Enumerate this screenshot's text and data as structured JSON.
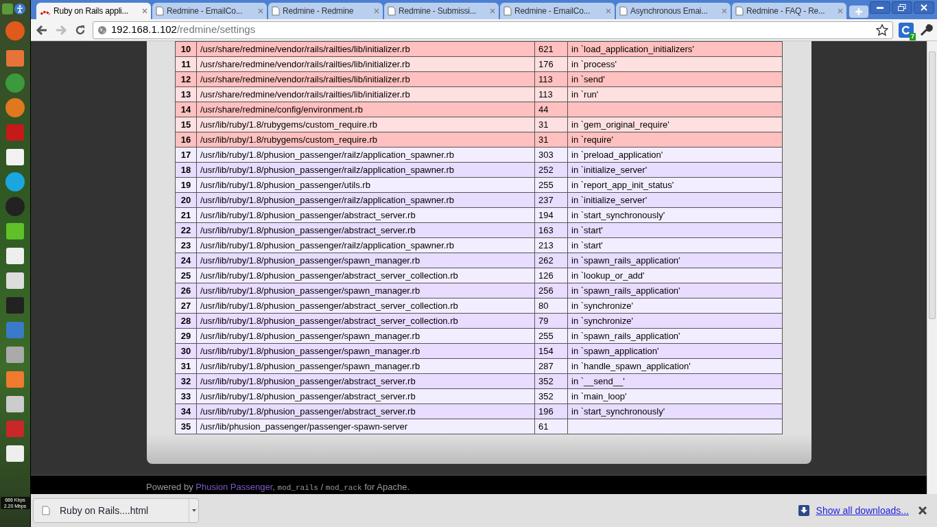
{
  "tabs": [
    {
      "label": "Ruby on Rails appli...",
      "selected": true,
      "kind": "rails"
    },
    {
      "label": "Redmine - EmailCo...",
      "selected": false,
      "kind": "page"
    },
    {
      "label": "Redmine - Redmine",
      "selected": false,
      "kind": "page"
    },
    {
      "label": "Redmine - Submissi...",
      "selected": false,
      "kind": "page"
    },
    {
      "label": "Redmine - EmailCo...",
      "selected": false,
      "kind": "page"
    },
    {
      "label": "Asynchronous Emai...",
      "selected": false,
      "kind": "page"
    },
    {
      "label": "Redmine - FAQ - Re...",
      "selected": false,
      "kind": "page"
    }
  ],
  "address": {
    "host": "192.168.1.102",
    "path": "/redmine/settings"
  },
  "extension_badge": "7",
  "launcher": {
    "net_up": "686 Kbps",
    "net_down": "2.20 Mbps"
  },
  "trace": [
    {
      "n": "10",
      "file": "/usr/share/redmine/vendor/rails/railties/lib/initializer.rb",
      "line": "621",
      "method": "in `load_application_initializers'",
      "kind": "app"
    },
    {
      "n": "11",
      "file": "/usr/share/redmine/vendor/rails/railties/lib/initializer.rb",
      "line": "176",
      "method": "in `process'",
      "kind": "app"
    },
    {
      "n": "12",
      "file": "/usr/share/redmine/vendor/rails/railties/lib/initializer.rb",
      "line": "113",
      "method": "in `send'",
      "kind": "app"
    },
    {
      "n": "13",
      "file": "/usr/share/redmine/vendor/rails/railties/lib/initializer.rb",
      "line": "113",
      "method": "in `run'",
      "kind": "app"
    },
    {
      "n": "14",
      "file": "/usr/share/redmine/config/environment.rb",
      "line": "44",
      "kind": "app"
    },
    {
      "n": "15",
      "file": "/usr/lib/ruby/1.8/rubygems/custom_require.rb",
      "line": "31",
      "method": "in `gem_original_require'",
      "kind": "app"
    },
    {
      "n": "16",
      "file": "/usr/lib/ruby/1.8/rubygems/custom_require.rb",
      "line": "31",
      "method": "in `require'",
      "kind": "app"
    },
    {
      "n": "17",
      "file": "/usr/lib/ruby/1.8/phusion_passenger/railz/application_spawner.rb",
      "line": "303",
      "method": "in `preload_application'",
      "kind": "framework"
    },
    {
      "n": "18",
      "file": "/usr/lib/ruby/1.8/phusion_passenger/railz/application_spawner.rb",
      "line": "252",
      "method": "in `initialize_server'",
      "kind": "framework"
    },
    {
      "n": "19",
      "file": "/usr/lib/ruby/1.8/phusion_passenger/utils.rb",
      "line": "255",
      "method": "in `report_app_init_status'",
      "kind": "framework"
    },
    {
      "n": "20",
      "file": "/usr/lib/ruby/1.8/phusion_passenger/railz/application_spawner.rb",
      "line": "237",
      "method": "in `initialize_server'",
      "kind": "framework"
    },
    {
      "n": "21",
      "file": "/usr/lib/ruby/1.8/phusion_passenger/abstract_server.rb",
      "line": "194",
      "method": "in `start_synchronously'",
      "kind": "framework"
    },
    {
      "n": "22",
      "file": "/usr/lib/ruby/1.8/phusion_passenger/abstract_server.rb",
      "line": "163",
      "method": "in `start'",
      "kind": "framework"
    },
    {
      "n": "23",
      "file": "/usr/lib/ruby/1.8/phusion_passenger/railz/application_spawner.rb",
      "line": "213",
      "method": "in `start'",
      "kind": "framework"
    },
    {
      "n": "24",
      "file": "/usr/lib/ruby/1.8/phusion_passenger/spawn_manager.rb",
      "line": "262",
      "method": "in `spawn_rails_application'",
      "kind": "framework"
    },
    {
      "n": "25",
      "file": "/usr/lib/ruby/1.8/phusion_passenger/abstract_server_collection.rb",
      "line": "126",
      "method": "in `lookup_or_add'",
      "kind": "framework"
    },
    {
      "n": "26",
      "file": "/usr/lib/ruby/1.8/phusion_passenger/spawn_manager.rb",
      "line": "256",
      "method": "in `spawn_rails_application'",
      "kind": "framework"
    },
    {
      "n": "27",
      "file": "/usr/lib/ruby/1.8/phusion_passenger/abstract_server_collection.rb",
      "line": "80",
      "method": "in `synchronize'",
      "kind": "framework"
    },
    {
      "n": "28",
      "file": "/usr/lib/ruby/1.8/phusion_passenger/abstract_server_collection.rb",
      "line": "79",
      "method": "in `synchronize'",
      "kind": "framework"
    },
    {
      "n": "29",
      "file": "/usr/lib/ruby/1.8/phusion_passenger/spawn_manager.rb",
      "line": "255",
      "method": "in `spawn_rails_application'",
      "kind": "framework"
    },
    {
      "n": "30",
      "file": "/usr/lib/ruby/1.8/phusion_passenger/spawn_manager.rb",
      "line": "154",
      "method": "in `spawn_application'",
      "kind": "framework"
    },
    {
      "n": "31",
      "file": "/usr/lib/ruby/1.8/phusion_passenger/spawn_manager.rb",
      "line": "287",
      "method": "in `handle_spawn_application'",
      "kind": "framework"
    },
    {
      "n": "32",
      "file": "/usr/lib/ruby/1.8/phusion_passenger/abstract_server.rb",
      "line": "352",
      "method": "in `__send__'",
      "kind": "framework"
    },
    {
      "n": "33",
      "file": "/usr/lib/ruby/1.8/phusion_passenger/abstract_server.rb",
      "line": "352",
      "method": "in `main_loop'",
      "kind": "framework"
    },
    {
      "n": "34",
      "file": "/usr/lib/ruby/1.8/phusion_passenger/abstract_server.rb",
      "line": "196",
      "method": "in `start_synchronously'",
      "kind": "framework"
    },
    {
      "n": "35",
      "file": "/usr/lib/phusion_passenger/passenger-spawn-server",
      "line": "61",
      "kind": "framework"
    }
  ],
  "footer": {
    "prefix": "Powered by",
    "link": "Phusion Passenger",
    "sep1": ",",
    "code1": "mod_rails",
    "sep2": "/",
    "code2": "mod_rack",
    "suffix": "for Apache."
  },
  "downloads": {
    "file": "Ruby on Rails....html",
    "show_all": "Show all downloads..."
  }
}
